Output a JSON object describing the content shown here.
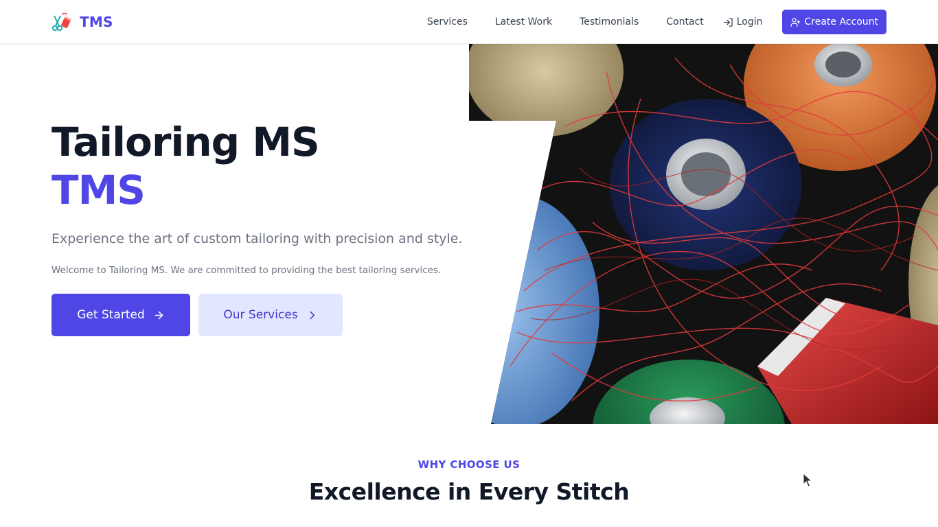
{
  "header": {
    "brand_name": "TMS",
    "nav": [
      "Services",
      "Latest Work",
      "Testimonials",
      "Contact"
    ],
    "login_label": "Login",
    "create_account_label": "Create Account"
  },
  "hero": {
    "title": "Tailoring MS",
    "title_accent": "TMS",
    "subtitle": "Experience the art of custom tailoring with precision and style.",
    "description": "Welcome to Tailoring MS. We are committed to providing the best tailoring services.",
    "primary_button": "Get Started",
    "secondary_button": "Our Services",
    "image_subject": "thread-spools"
  },
  "features": {
    "kicker": "WHY CHOOSE US",
    "title": "Excellence in Every Stitch"
  },
  "colors": {
    "accent": "#4f46e5",
    "accent_light": "#e0e7ff",
    "heading": "#111827",
    "muted": "#6b7280"
  },
  "icons": [
    "sewing-logo-icon",
    "login-icon",
    "user-plus-icon",
    "arrow-right-icon",
    "chevron-right-icon",
    "mouse-cursor-icon"
  ]
}
